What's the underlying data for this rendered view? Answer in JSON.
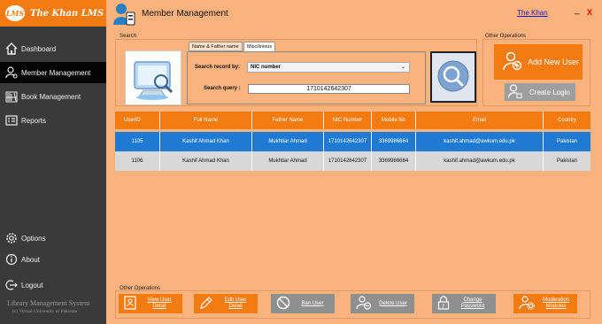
{
  "app": {
    "logo_badge": "LMS",
    "logo_text": "The Khan LMS"
  },
  "sidebar": {
    "items": [
      {
        "label": "Dashboard",
        "icon": "home-icon"
      },
      {
        "label": "Member Management",
        "icon": "user-gear-icon"
      },
      {
        "label": "Book Management",
        "icon": "bookshelf-icon"
      },
      {
        "label": "Reports",
        "icon": "report-icon"
      },
      {
        "label": "Options",
        "icon": "gear-icon"
      },
      {
        "label": "About",
        "icon": "info-icon"
      },
      {
        "label": "Logout",
        "icon": "logout-icon"
      }
    ],
    "footer_title": "Library Management System",
    "footer_subtitle": "(c) Virtual University of Pakistan"
  },
  "header": {
    "title": "Member Management",
    "user": "The Khan",
    "minimize": "_",
    "close": "X"
  },
  "search": {
    "legend": "Search",
    "tabs": [
      "Name & Father name",
      "Miscilinious"
    ],
    "record_label": "Search record by:",
    "record_value": "NIC number",
    "query_label": "Search query :",
    "query_value": "1710142642307"
  },
  "other_ops": {
    "legend": "Other Operations",
    "add_user": "Add New User",
    "create_login": "Create Login"
  },
  "table": {
    "columns": [
      "UserID",
      "Full Name",
      "Father Name",
      "NIC Number",
      "Mobile No",
      "Email",
      "Country"
    ],
    "rows": [
      [
        "1105",
        "Kashif Ahmad Khan",
        "Mukhtiar Ahmad",
        "1710142642307",
        "3369986664",
        "kashif.ahmad@awkum.edu.pk",
        "Pakistan"
      ],
      [
        "1106",
        "Kashif Ahmad Khan",
        "Mukhtiar Ahmad",
        "1710142642307",
        "3369986664",
        "kashif.ahmad@awkum.edu.pk",
        "Pakistan"
      ]
    ]
  },
  "bottom_ops": {
    "legend": "Other Operations",
    "buttons": [
      {
        "label1": "View User",
        "label2": "Detail"
      },
      {
        "label1": "Edit User",
        "label2": "Detail"
      },
      {
        "label1": "Ban User",
        "label2": ""
      },
      {
        "label1": "Delete User",
        "label2": ""
      },
      {
        "label1": "Change",
        "label2": "Password"
      },
      {
        "label1": "Moderation",
        "label2": "Modules"
      }
    ]
  },
  "colors": {
    "accent": "#f37b10",
    "background": "#fab37c",
    "sidebar": "#3a3a3a",
    "selected_row": "#1f7ad4"
  }
}
